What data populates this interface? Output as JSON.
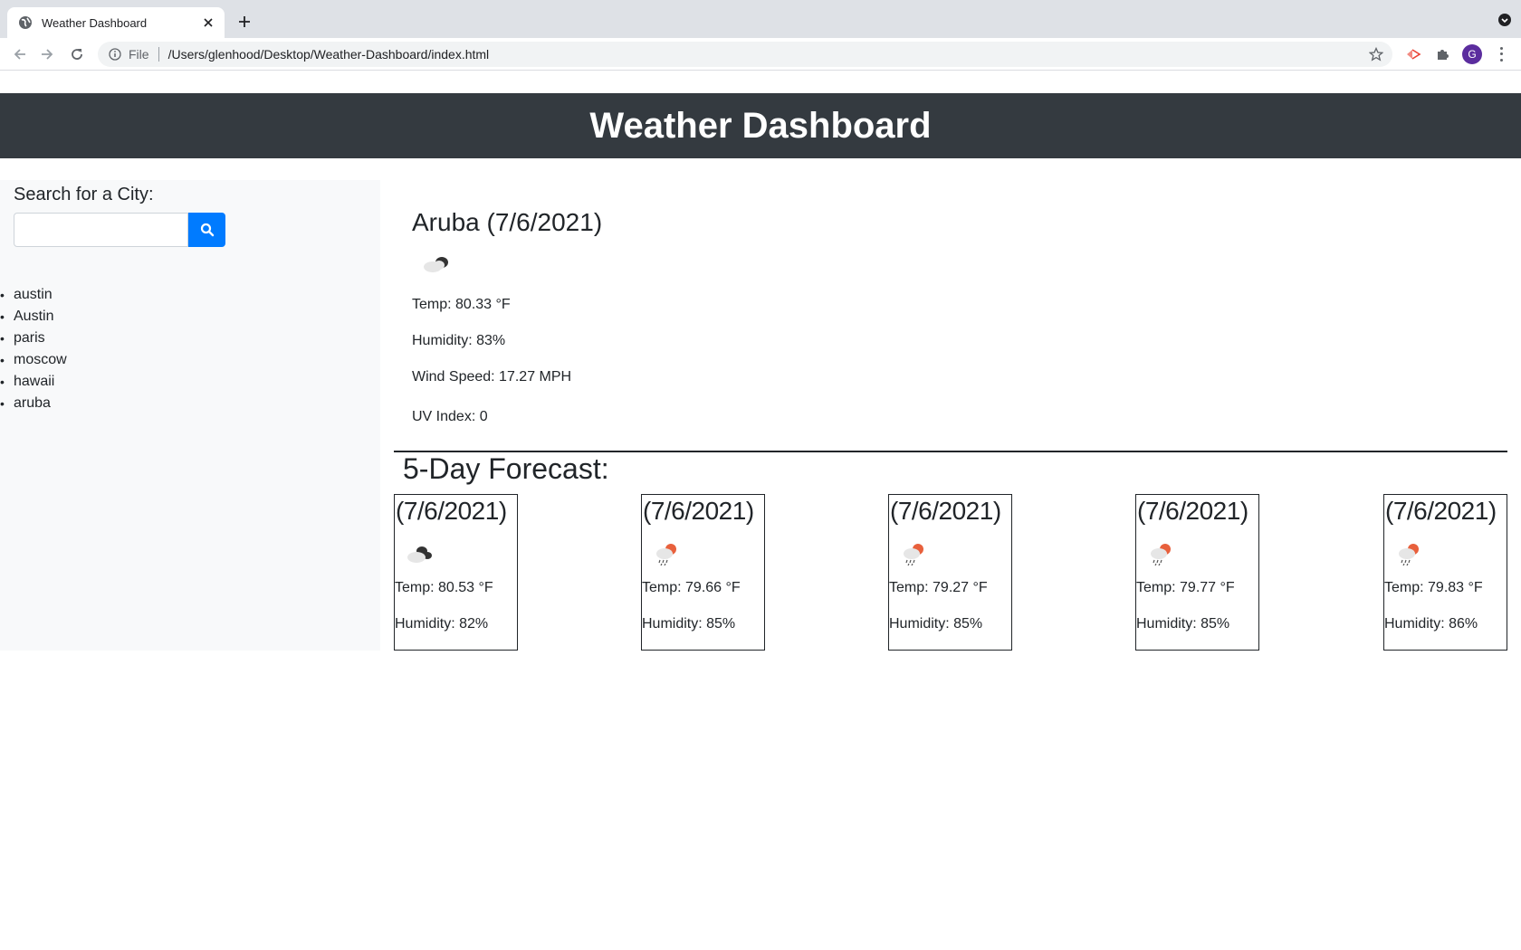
{
  "browser": {
    "tab_title": "Weather Dashboard",
    "url_scheme": "File",
    "url": "/Users/glenhood/Desktop/Weather-Dashboard/index.html",
    "profile_initial": "G"
  },
  "header": {
    "title": "Weather Dashboard"
  },
  "sidebar": {
    "search_label": "Search for a City:",
    "search_value": "",
    "history": [
      "austin",
      "Austin",
      "paris",
      "moscow",
      "hawaii",
      "aruba"
    ]
  },
  "current": {
    "title": "Aruba (7/6/2021)",
    "icon": "broken-clouds-night-icon",
    "temp": "Temp: 80.33 °F",
    "humidity": "Humidity: 83%",
    "wind": "Wind Speed: 17.27 MPH",
    "uv": "UV Index: 0"
  },
  "forecast": {
    "title": "5-Day Forecast:",
    "days": [
      {
        "date": "(7/6/2021)",
        "icon": "broken-clouds-night-icon",
        "temp": "Temp: 80.53 °F",
        "humidity": "Humidity: 82%"
      },
      {
        "date": "(7/6/2021)",
        "icon": "rain-day-icon",
        "temp": "Temp: 79.66 °F",
        "humidity": "Humidity: 85%"
      },
      {
        "date": "(7/6/2021)",
        "icon": "rain-day-icon",
        "temp": "Temp: 79.27 °F",
        "humidity": "Humidity: 85%"
      },
      {
        "date": "(7/6/2021)",
        "icon": "rain-day-icon",
        "temp": "Temp: 79.77 °F",
        "humidity": "Humidity: 85%"
      },
      {
        "date": "(7/6/2021)",
        "icon": "rain-day-icon",
        "temp": "Temp: 79.83 °F",
        "humidity": "Humidity: 86%"
      }
    ]
  },
  "colors": {
    "header_bg": "#343a40",
    "search_button": "#007bff",
    "sidebar_bg": "#f8f9fa",
    "rain_sun": "#e8603c"
  }
}
